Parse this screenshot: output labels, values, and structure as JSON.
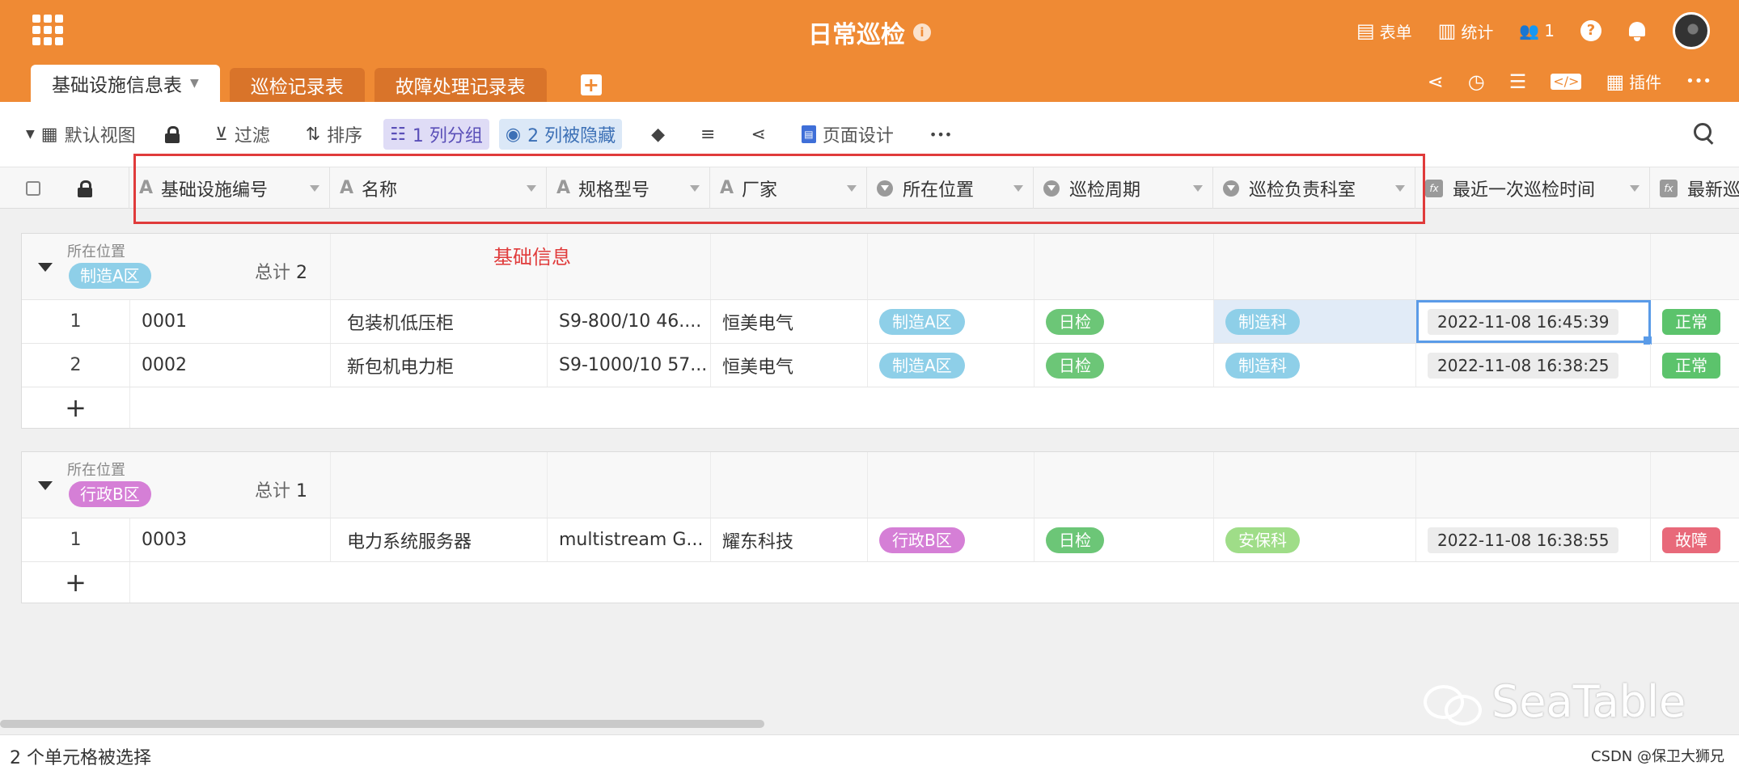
{
  "app": {
    "title": "日常巡检",
    "info_glyph": "i",
    "top_actions": [
      {
        "icon": "form-icon",
        "glyph": "▤",
        "label": "表单"
      },
      {
        "icon": "stats-icon",
        "glyph": "▥",
        "label": "统计"
      },
      {
        "icon": "users-icon",
        "glyph": "👥",
        "label": "1"
      }
    ],
    "help_glyph": "?"
  },
  "tabs": [
    {
      "label": "基础设施信息表",
      "active": true
    },
    {
      "label": "巡检记录表",
      "active": false
    },
    {
      "label": "故障处理记录表",
      "active": false
    }
  ],
  "add_tab_glyph": "+",
  "tab_actions": {
    "share_glyph": "⋖",
    "history_glyph": "◷",
    "settings_glyph": "☰",
    "script_glyph": "</>",
    "plugin_glyph": "▦",
    "plugin_label": "插件",
    "more_glyph": "•••"
  },
  "toolbar": {
    "view_caret": "▼",
    "view_glyph": "▦",
    "view_label": "默认视图",
    "filter_glyph": "⊻",
    "filter_label": "过滤",
    "sort_glyph": "⇅",
    "sort_label": "排序",
    "group_glyph": "☷",
    "group_label": "1 列分组",
    "hidden_glyph": "◉",
    "hidden_label": "2 列被隐藏",
    "paint_glyph": "◆",
    "rowheight_glyph": "≡",
    "share_glyph": "⋖",
    "page_glyph": "▤",
    "page_label": "页面设计",
    "more_glyph": "•••"
  },
  "columns": [
    {
      "label": "基础设施编号",
      "type": "text"
    },
    {
      "label": "名称",
      "type": "text"
    },
    {
      "label": "规格型号",
      "type": "text"
    },
    {
      "label": "厂家",
      "type": "text"
    },
    {
      "label": "所在位置",
      "type": "select"
    },
    {
      "label": "巡检周期",
      "type": "select"
    },
    {
      "label": "巡检负责科室",
      "type": "select"
    },
    {
      "label": "最近一次巡检时间",
      "type": "formula"
    },
    {
      "label": "最新巡",
      "type": "formula"
    }
  ],
  "type_glyphs": {
    "text": "A",
    "formula": "fx"
  },
  "annotation": "基础信息",
  "groups": [
    {
      "group_label": "所在位置",
      "group_value": "制造A区",
      "group_color": "#8ecfe8",
      "count_label": "总计",
      "count": "2",
      "rows": [
        {
          "num": "1",
          "id": "0001",
          "name": "包装机低压柜",
          "model": "S9-800/10 46....",
          "maker": "恒美电气",
          "location": "制造A区",
          "cycle": "日检",
          "dept": "制造科",
          "time": "2022-11-08 16:45:39",
          "status": "正常"
        },
        {
          "num": "2",
          "id": "0002",
          "name": "新包机电力柜",
          "model": "S9-1000/10 57...",
          "maker": "恒美电气",
          "location": "制造A区",
          "cycle": "日检",
          "dept": "制造科",
          "time": "2022-11-08 16:38:25",
          "status": "正常"
        }
      ]
    },
    {
      "group_label": "所在位置",
      "group_value": "行政B区",
      "group_color": "#d57fd6",
      "count_label": "总计",
      "count": "1",
      "rows": [
        {
          "num": "1",
          "id": "0003",
          "name": "电力系统服务器",
          "model": "multistream G...",
          "maker": "耀东科技",
          "location": "行政B区",
          "cycle": "日检",
          "dept": "安保科",
          "time": "2022-11-08 16:38:55",
          "status": "故障"
        }
      ]
    }
  ],
  "add_row_glyph": "+",
  "colors": {
    "brand": "#ef8a34",
    "location_a": "#8ecfe8",
    "location_b": "#d57fd6",
    "cycle": "#6cc677",
    "dept_mfg": "#8ecfe8",
    "dept_sec": "#9fdd88",
    "status_ok": "#5cc36c",
    "status_fault": "#e8697a"
  },
  "status_bar": {
    "text": "2 个单元格被选择"
  },
  "watermark": "SeaTable",
  "credit": "CSDN @保卫大狮兄"
}
